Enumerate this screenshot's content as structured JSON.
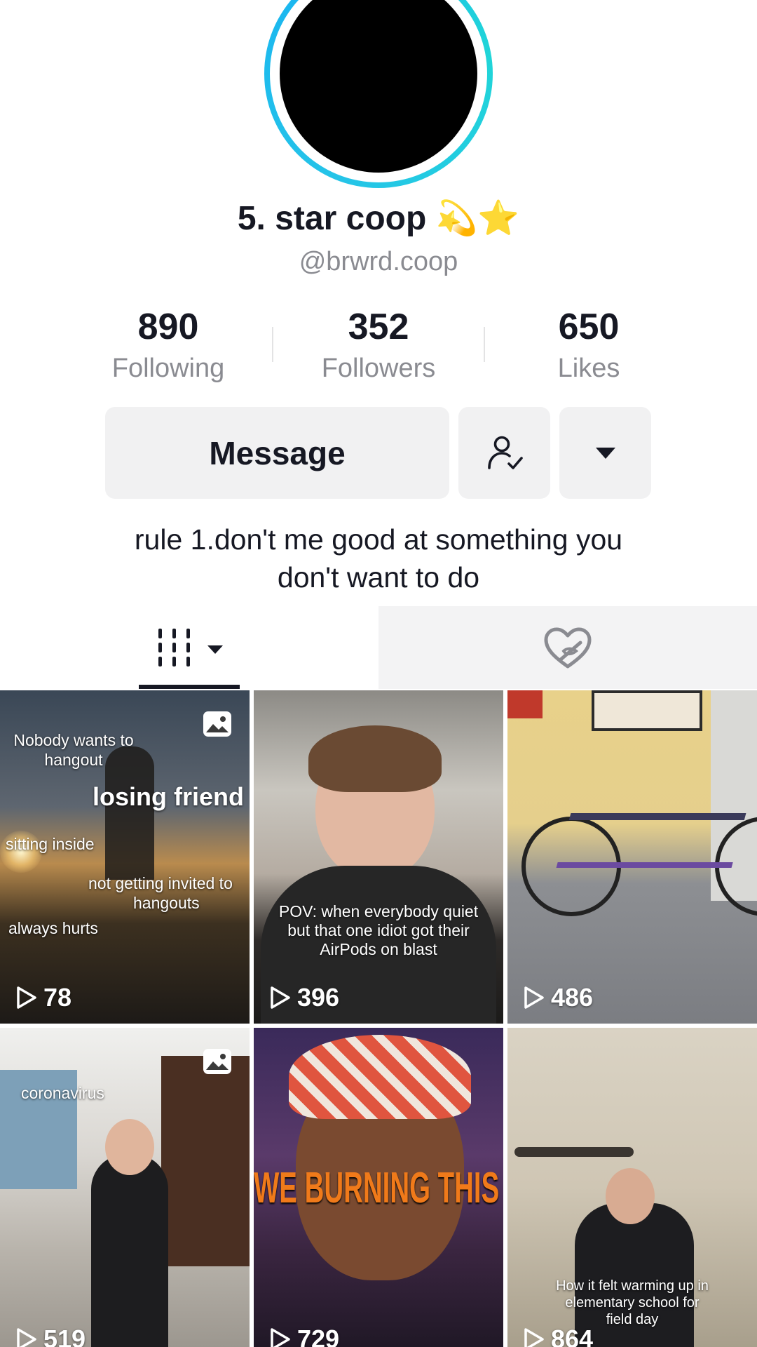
{
  "profile": {
    "display_name": "5. star coop 💫⭐",
    "username": "@brwrd.coop",
    "bio_line1": "rule 1.don't me good at something you",
    "bio_line2": "don't want to do"
  },
  "stats": {
    "following_count": "890",
    "following_label": "Following",
    "followers_count": "352",
    "followers_label": "Followers",
    "likes_count": "650",
    "likes_label": "Likes"
  },
  "actions": {
    "message_label": "Message",
    "follow_icon": "user-check-icon",
    "more_icon": "caret-down-icon"
  },
  "tabs": {
    "videos_icon": "grid-videos-icon",
    "liked_icon": "hidden-likes-heart-icon"
  },
  "videos": [
    {
      "views": "78",
      "photo_post": true,
      "captions": [
        "Nobody wants to",
        "hangout",
        "losing friend",
        "sitting inside",
        "not getting invited to",
        "hangouts",
        "always hurts"
      ]
    },
    {
      "views": "396",
      "captions": [
        "POV: when everybody quiet",
        "but that one idiot got their",
        "AirPods on blast"
      ]
    },
    {
      "views": "486",
      "captions": []
    },
    {
      "views": "519",
      "photo_post": true,
      "captions": [
        "coronavirus"
      ]
    },
    {
      "views": "729",
      "captions": [
        "WE BURNING THIS"
      ]
    },
    {
      "views": "864",
      "captions": [
        "How it felt warming up in",
        "elementary school for",
        "field day"
      ]
    }
  ],
  "colors": {
    "text_primary": "#161823",
    "text_secondary": "#8a8b91",
    "button_bg": "#f1f1f2",
    "avatar_ring": "#25c4e8"
  }
}
